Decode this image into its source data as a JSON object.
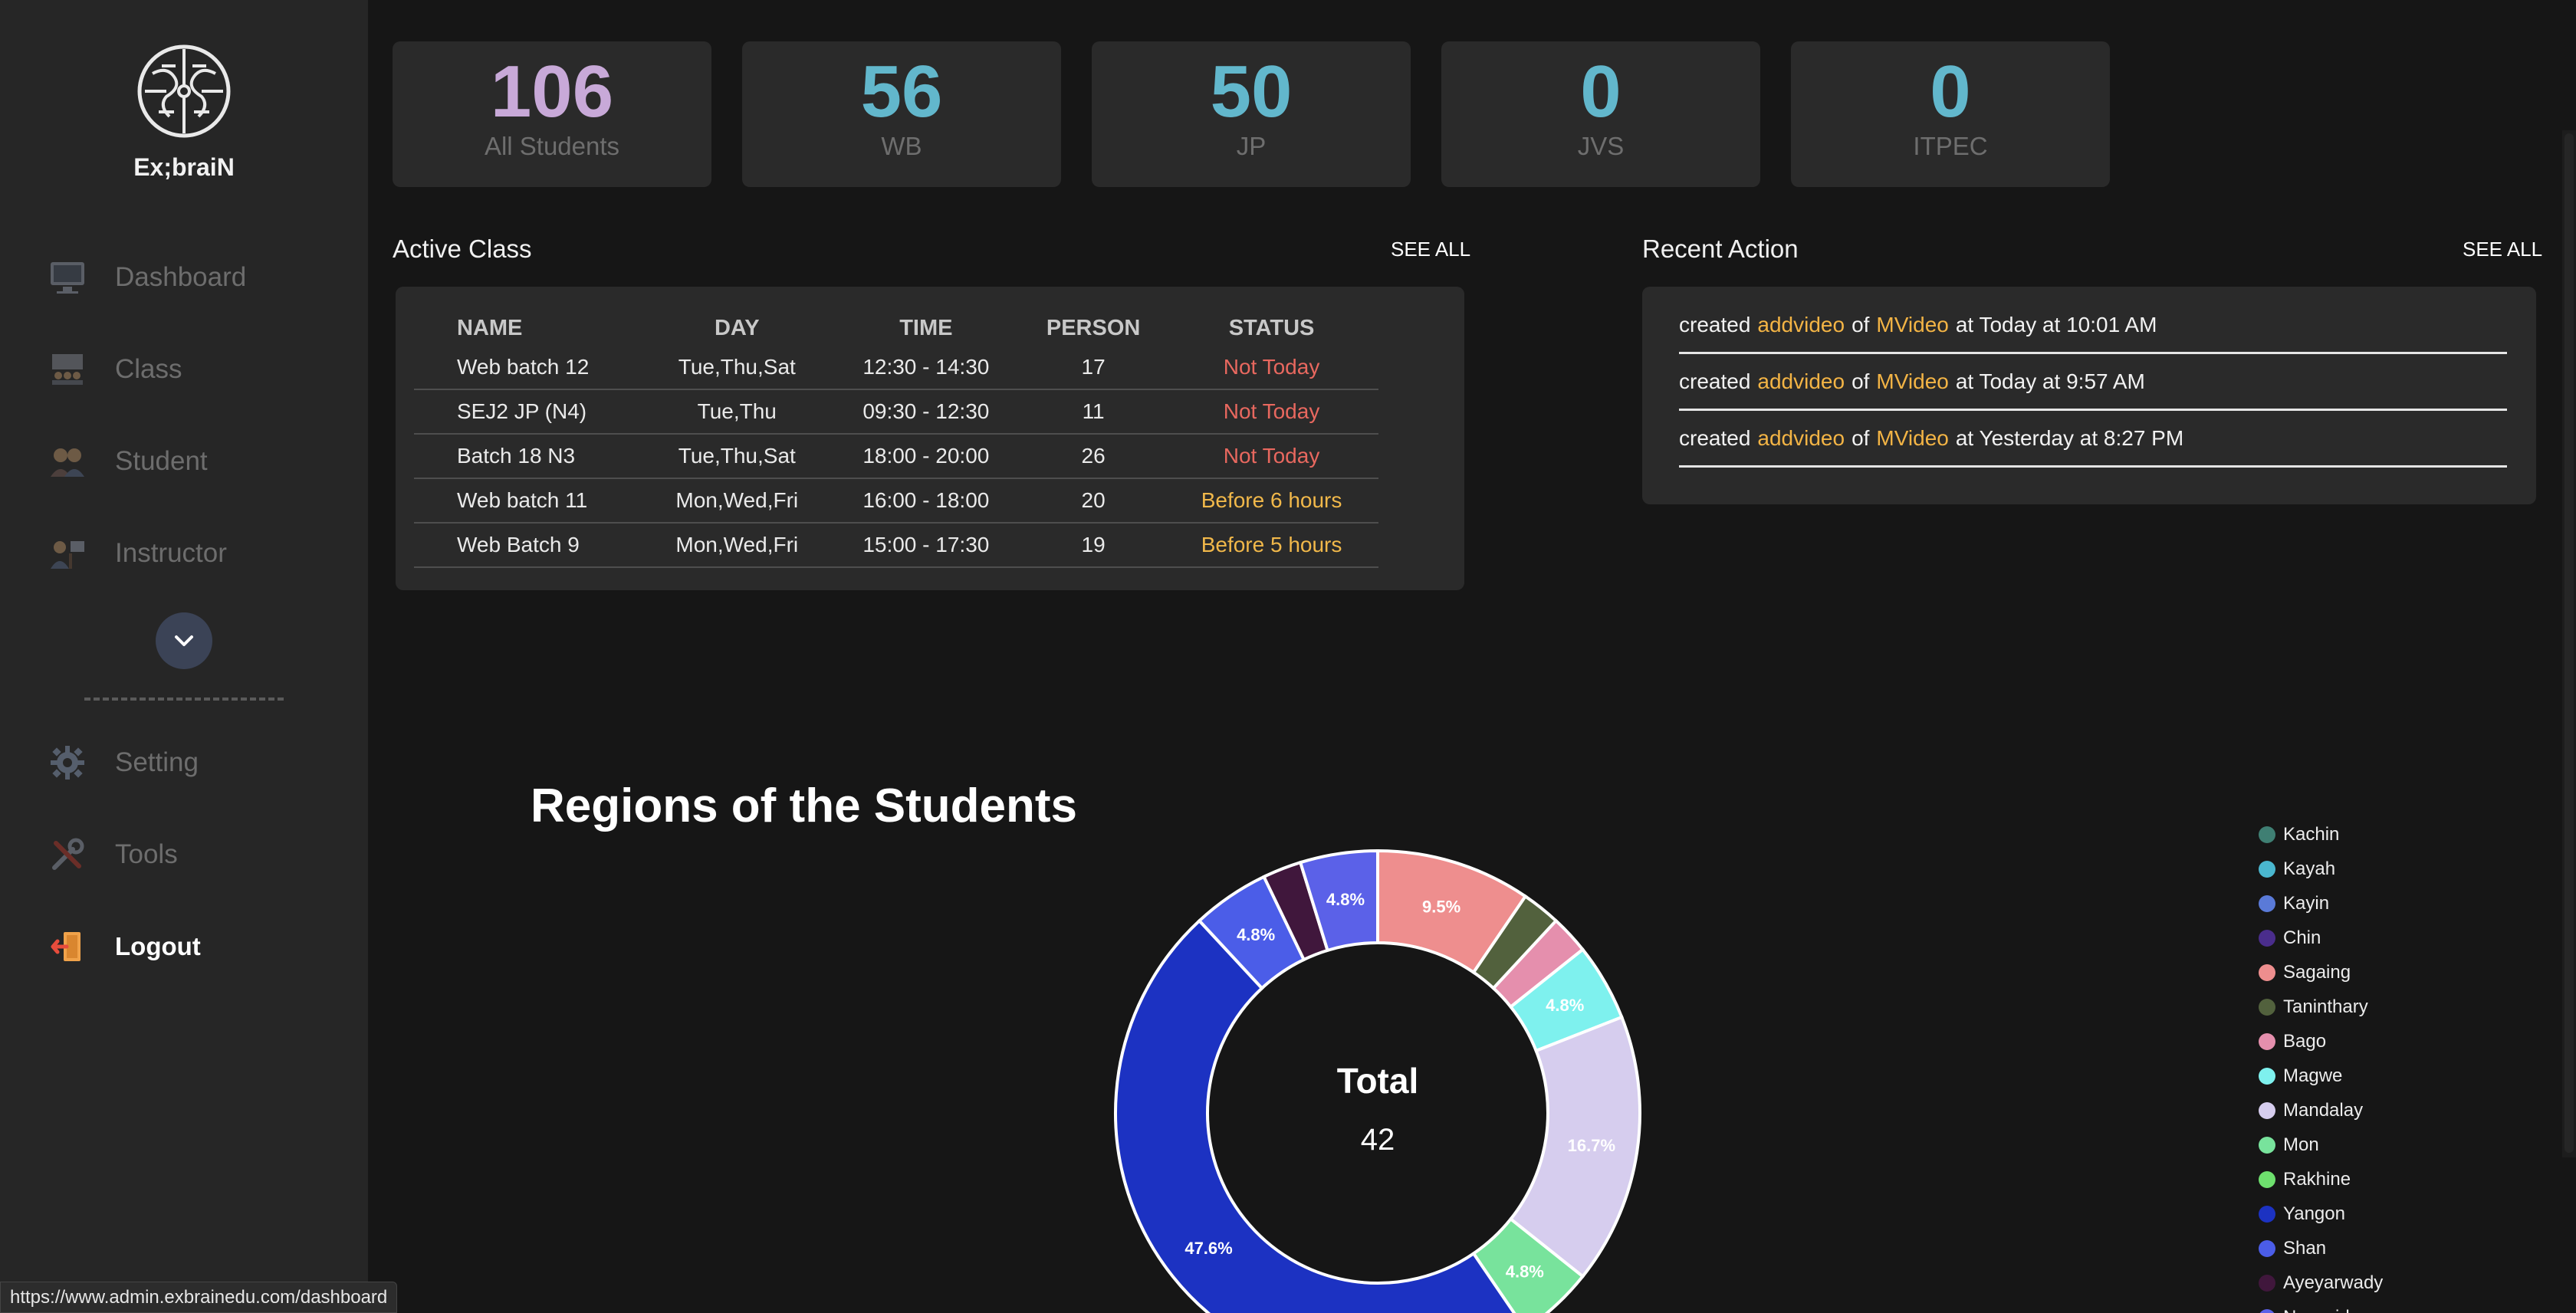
{
  "brand": {
    "name": "Ex;braiN"
  },
  "sidebar": {
    "items": [
      {
        "label": "Dashboard",
        "icon": "dashboard-icon"
      },
      {
        "label": "Class",
        "icon": "class-icon"
      },
      {
        "label": "Student",
        "icon": "student-icon"
      },
      {
        "label": "Instructor",
        "icon": "instructor-icon"
      }
    ],
    "expand_icon": "chevron-down-icon",
    "bottom_items": [
      {
        "label": "Setting",
        "icon": "gear-icon"
      },
      {
        "label": "Tools",
        "icon": "tools-icon"
      },
      {
        "label": "Logout",
        "icon": "logout-icon"
      }
    ]
  },
  "stats": [
    {
      "value": "106",
      "label": "All Students",
      "color": "#c8a9d8"
    },
    {
      "value": "56",
      "label": "WB",
      "color": "#62b7cc"
    },
    {
      "value": "50",
      "label": "JP",
      "color": "#62b7cc"
    },
    {
      "value": "0",
      "label": "JVS",
      "color": "#62b7cc"
    },
    {
      "value": "0",
      "label": "ITPEC",
      "color": "#62b7cc"
    }
  ],
  "active_class": {
    "title": "Active Class",
    "see_all": "SEE ALL",
    "headers": [
      "NAME",
      "DAY",
      "TIME",
      "PERSON",
      "STATUS"
    ],
    "rows": [
      {
        "name": "Web batch 12",
        "day": "Tue,Thu,Sat",
        "time": "12:30 - 14:30",
        "person": "17",
        "status": "Not Today"
      },
      {
        "name": "SEJ2 JP (N4)",
        "day": "Tue,Thu",
        "time": "09:30 - 12:30",
        "person": "11",
        "status": "Not Today"
      },
      {
        "name": "Batch 18 N3",
        "day": "Tue,Thu,Sat",
        "time": "18:00 - 20:00",
        "person": "26",
        "status": "Not Today"
      },
      {
        "name": "Web batch 11",
        "day": "Mon,Wed,Fri",
        "time": "16:00 - 18:00",
        "person": "20",
        "status": "Before 6 hours"
      },
      {
        "name": "Web Batch 9",
        "day": "Mon,Wed,Fri",
        "time": "15:00 - 17:30",
        "person": "19",
        "status": "Before 5 hours"
      }
    ]
  },
  "recent_action": {
    "title": "Recent Action",
    "see_all": "SEE ALL",
    "items": [
      {
        "verb": "created",
        "target": "addvideo",
        "of": "of",
        "model": "MVideo",
        "time": "at Today at 10:01 AM"
      },
      {
        "verb": "created",
        "target": "addvideo",
        "of": "of",
        "model": "MVideo",
        "time": "at Today at 9:57 AM"
      },
      {
        "verb": "created",
        "target": "addvideo",
        "of": "of",
        "model": "MVideo",
        "time": "at Yesterday at 8:27 PM"
      }
    ]
  },
  "status_url": "https://www.admin.exbrainedu.com/dashboard",
  "chart_data": {
    "type": "pie",
    "title": "Regions of the Students",
    "center_label": "Total",
    "center_value": "42",
    "legend_position": "right",
    "series": [
      {
        "name": "Kachin",
        "value": 0,
        "color": "#3f7f73"
      },
      {
        "name": "Kayah",
        "value": 0,
        "color": "#4ab7cf"
      },
      {
        "name": "Kayin",
        "value": 0,
        "color": "#5a7ad8"
      },
      {
        "name": "Chin",
        "value": 0,
        "color": "#4a2d8c"
      },
      {
        "name": "Sagaing",
        "value": 4,
        "color": "#ee8e8e",
        "label": "9.5%"
      },
      {
        "name": "Taninthary",
        "value": 1,
        "color": "#52613d"
      },
      {
        "name": "Bago",
        "value": 1,
        "color": "#e58fad"
      },
      {
        "name": "Magwe",
        "value": 2,
        "color": "#7ef1ee",
        "label": "4.8%"
      },
      {
        "name": "Mandalay",
        "value": 7,
        "color": "#d6cdee",
        "label": "16.7%"
      },
      {
        "name": "Mon",
        "value": 2,
        "color": "#78e39c",
        "label": "4.8%"
      },
      {
        "name": "Rakhine",
        "value": 0,
        "color": "#6ee06e"
      },
      {
        "name": "Yangon",
        "value": 20,
        "color": "#1c32c2",
        "label": "47.6%"
      },
      {
        "name": "Shan",
        "value": 2,
        "color": "#4b5de8",
        "label": "4.8%"
      },
      {
        "name": "Ayeyarwady",
        "value": 1,
        "color": "#40173c"
      },
      {
        "name": "Naypyidaw",
        "value": 2,
        "color": "#5b61e8",
        "label": "4.8%"
      }
    ]
  }
}
